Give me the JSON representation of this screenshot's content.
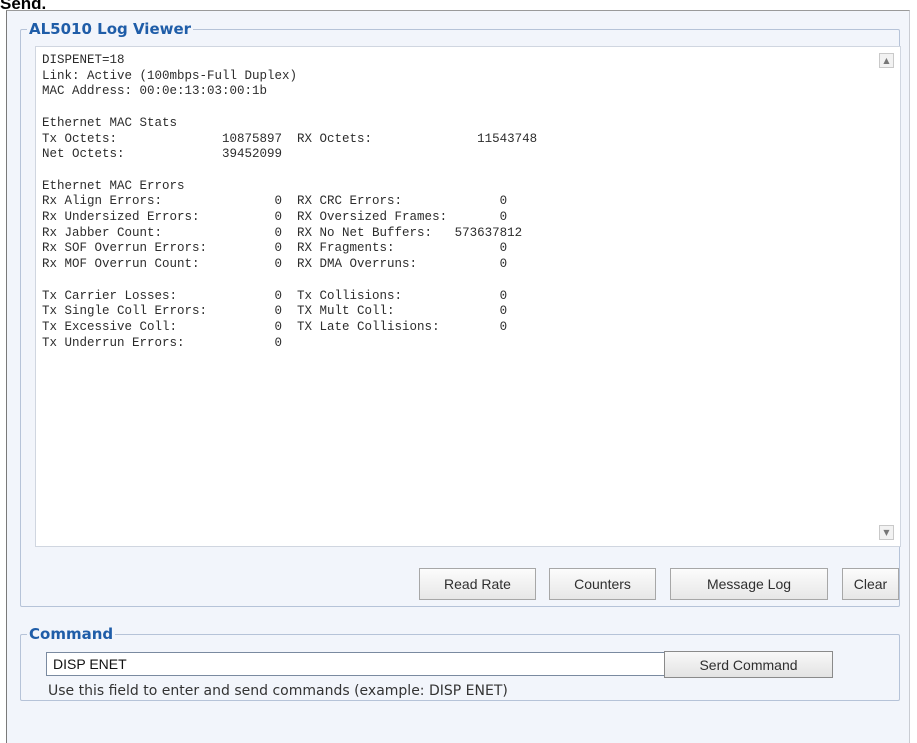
{
  "page": {
    "top_label": "Send."
  },
  "log_viewer": {
    "title": "AL5010 Log Viewer",
    "log_lines": [
      "DISPENET=18",
      "Link: Active (100mbps-Full Duplex)",
      "MAC Address: 00:0e:13:03:00:1b",
      "",
      "Ethernet MAC Stats",
      "Tx Octets:              10875897  RX Octets:              11543748",
      "Net Octets:             39452099",
      "",
      "Ethernet MAC Errors",
      "Rx Align Errors:               0  RX CRC Errors:             0",
      "Rx Undersized Errors:          0  RX Oversized Frames:       0",
      "Rx Jabber Count:               0  RX No Net Buffers:   573637812",
      "Rx SOF Overrun Errors:         0  RX Fragments:              0",
      "Rx MOF Overrun Count:          0  RX DMA Overruns:           0",
      "",
      "Tx Carrier Losses:             0  Tx Collisions:             0",
      "Tx Single Coll Errors:         0  TX Mult Coll:              0",
      "Tx Excessive Coll:             0  TX Late Collisions:        0",
      "Tx Underrun Errors:            0"
    ],
    "buttons": {
      "read_rate": "Read Rate",
      "counters": "Counters",
      "message_log": "Message Log",
      "clear": "Clear"
    },
    "scroll_up_icon": "triangle-up",
    "scroll_down_icon": "triangle-down"
  },
  "command": {
    "title": "Command",
    "input_value": "DISP ENET",
    "send_label": "Serd Command",
    "hint": "Use this field to enter and send commands (example: DISP ENET)"
  },
  "colors": {
    "legend_blue": "#1f5da8",
    "panel_bg": "#f2f5fb",
    "box_border": "#b6c3d8"
  }
}
